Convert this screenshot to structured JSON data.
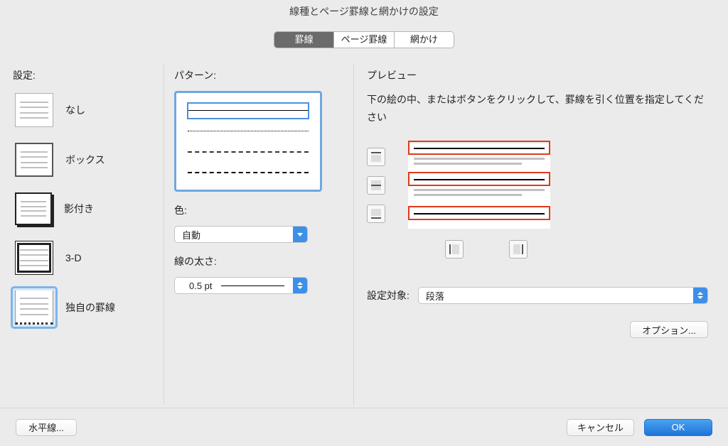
{
  "title": "線種とページ罫線と網かけの設定",
  "tabs": {
    "t0": "罫線",
    "t1": "ページ罫線",
    "t2": "網かけ"
  },
  "left": {
    "heading": "設定:",
    "presets": {
      "p0": "なし",
      "p1": "ボックス",
      "p2": "影付き",
      "p3": "3-D",
      "p4": "独自の罫線"
    }
  },
  "mid": {
    "pattern_label": "パターン:",
    "color_label": "色:",
    "color_value": "自動",
    "width_label": "線の太さ:",
    "width_value": "0.5 pt"
  },
  "right": {
    "heading": "プレビュー",
    "help": "下の絵の中、またはボタンをクリックして、罫線を引く位置を指定してください",
    "apply_label": "設定対象:",
    "apply_value": "段落",
    "options_btn": "オプション..."
  },
  "footer": {
    "hline": "水平線...",
    "cancel": "キャンセル",
    "ok": "OK"
  }
}
